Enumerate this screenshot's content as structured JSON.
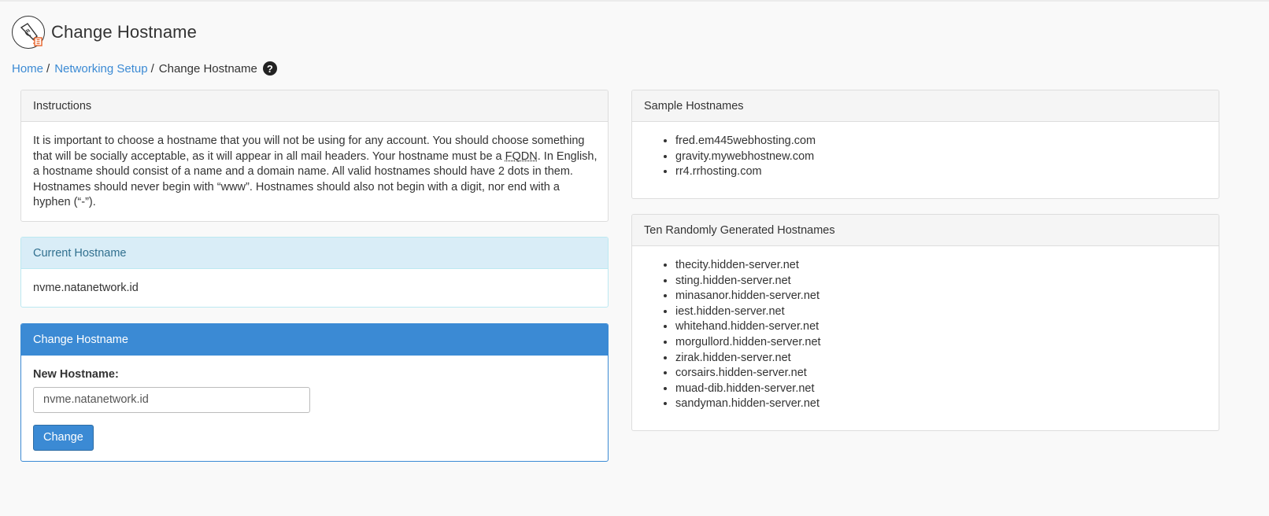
{
  "header": {
    "title": "Change Hostname",
    "icon": "network-hostname-icon"
  },
  "breadcrumb": {
    "home": "Home",
    "separator": "/",
    "networking": "Networking Setup",
    "current": "Change Hostname",
    "help": "?"
  },
  "instructions": {
    "heading": "Instructions",
    "text_before": "It is important to choose a hostname that you will not be using for any account. You should choose something that will be socially acceptable, as it will appear in all mail headers. Your hostname must be a ",
    "abbr": "FQDN",
    "text_after": ". In English, a hostname should consist of a name and a domain name. All valid hostnames should have 2 dots in them. Hostnames should never begin with “www”. Hostnames should also not begin with a digit, nor end with a hyphen (“-”)."
  },
  "current": {
    "heading": "Current Hostname",
    "value": "nvme.natanetwork.id"
  },
  "change": {
    "heading": "Change Hostname",
    "label": "New Hostname:",
    "input_value": "nvme.natanetwork.id",
    "button": "Change"
  },
  "samples": {
    "heading": "Sample Hostnames",
    "items": [
      "fred.em445webhosting.com",
      "gravity.mywebhostnew.com",
      "rr4.rrhosting.com"
    ]
  },
  "random": {
    "heading": "Ten Randomly Generated Hostnames",
    "items": [
      "thecity.hidden-server.net",
      "sting.hidden-server.net",
      "minasanor.hidden-server.net",
      "iest.hidden-server.net",
      "whitehand.hidden-server.net",
      "morgullord.hidden-server.net",
      "zirak.hidden-server.net",
      "corsairs.hidden-server.net",
      "muad-dib.hidden-server.net",
      "sandyman.hidden-server.net"
    ]
  },
  "colors": {
    "link": "#3b8ad4",
    "primary": "#3b8ad4",
    "info_bg": "#d9edf7",
    "info_text": "#31708f",
    "icon_accent": "#e8632a"
  }
}
